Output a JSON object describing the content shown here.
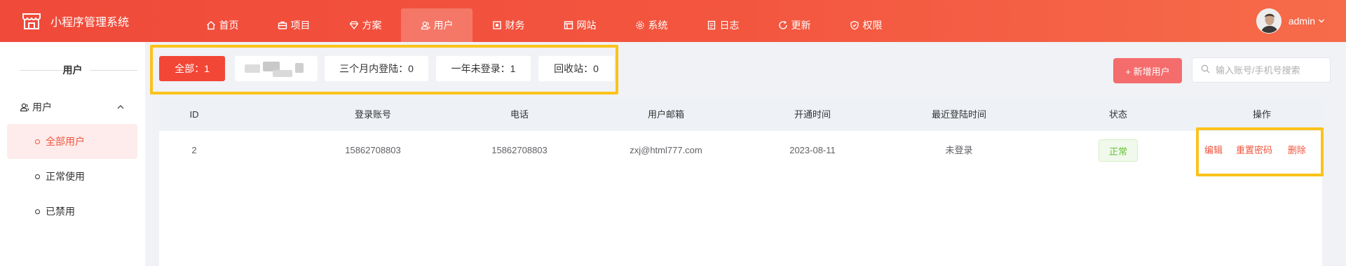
{
  "header": {
    "app_title": "小程序管理系统",
    "nav": [
      {
        "label": "首页",
        "icon": "home-icon"
      },
      {
        "label": "项目",
        "icon": "briefcase-icon"
      },
      {
        "label": "方案",
        "icon": "diamond-icon"
      },
      {
        "label": "用户",
        "icon": "users-icon",
        "active": true
      },
      {
        "label": "财务",
        "icon": "finance-icon"
      },
      {
        "label": "网站",
        "icon": "website-icon"
      },
      {
        "label": "系统",
        "icon": "gear-icon"
      },
      {
        "label": "日志",
        "icon": "log-icon"
      },
      {
        "label": "更新",
        "icon": "refresh-icon"
      },
      {
        "label": "权限",
        "icon": "shield-check-icon"
      }
    ],
    "user_name": "admin"
  },
  "sidebar": {
    "title": "用户",
    "group_label": "用户",
    "items": [
      {
        "label": "全部用户",
        "active": true
      },
      {
        "label": "正常使用"
      },
      {
        "label": "已禁用"
      }
    ]
  },
  "filters": {
    "all": "全部：1",
    "three_months": "三个月内登陆：0",
    "one_year": "一年未登录：1",
    "recycle": "回收站：0"
  },
  "toolbar": {
    "add_user": "+ 新增用户",
    "search_placeholder": "输入账号/手机号搜索"
  },
  "table": {
    "columns": [
      "ID",
      "登录账号",
      "电话",
      "用户邮箱",
      "开通时间",
      "最近登陆时间",
      "状态",
      "操作"
    ],
    "rows": [
      {
        "id": "2",
        "account": "15862708803",
        "phone": "15862708803",
        "email": "zxj@html777.com",
        "opened": "2023-08-11",
        "last_login": "未登录",
        "status": "正常"
      }
    ],
    "actions": [
      "编辑",
      "重置密码",
      "删除"
    ]
  },
  "colors": {
    "brand": "#f24637",
    "status_ok": "#67c23a",
    "highlight": "#fbc21b"
  }
}
